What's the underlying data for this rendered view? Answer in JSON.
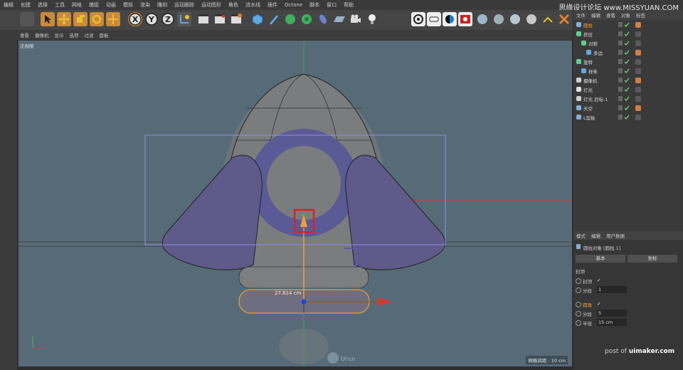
{
  "menubar": {
    "items": [
      "编辑",
      "创建",
      "选择",
      "工具",
      "网格",
      "捕捉",
      "动画",
      "模拟",
      "渲染",
      "雕刻",
      "运动跟踪",
      "运动图形",
      "角色",
      "流水线",
      "插件",
      "Octane",
      "脚本",
      "窗口",
      "帮助"
    ],
    "watermark": "思缘设计论坛 www.MISSYUAN.COM"
  },
  "toolbar": {
    "axis_x": "X",
    "axis_y": "Y",
    "axis_z": "Z"
  },
  "viewport_header": {
    "items": [
      "查看",
      "摄像机",
      "显示",
      "选项",
      "过滤",
      "面板"
    ]
  },
  "viewport": {
    "label": "正视图",
    "measure": "27.614 cm",
    "grid_info": "网格间距 : 10 cm",
    "logo_text": "UI·cn"
  },
  "object_manager": {
    "header": [
      "文件",
      "编辑",
      "查看",
      "对象",
      "标签"
    ],
    "objects": [
      {
        "name": "圆柱",
        "indent": 0,
        "icon": "cylinder-icon",
        "color": "#7fb0e0",
        "highlight": true
      },
      {
        "name": "挤压",
        "indent": 0,
        "icon": "extrude-icon",
        "color": "#5fcf8a",
        "highlight": false
      },
      {
        "name": "对称",
        "indent": 1,
        "icon": "symmetry-icon",
        "color": "#5fcf8a",
        "highlight": false
      },
      {
        "name": "多边",
        "indent": 2,
        "icon": "polygon-spline-icon",
        "color": "#5fa8e0",
        "highlight": false
      },
      {
        "name": "旋转",
        "indent": 0,
        "icon": "lathe-icon",
        "color": "#5fcf8a",
        "highlight": false
      },
      {
        "name": "样条",
        "indent": 1,
        "icon": "spline-icon",
        "color": "#5fa8e0",
        "highlight": false
      },
      {
        "name": "摄像机",
        "indent": 0,
        "icon": "camera-icon",
        "color": "#cfcfcf",
        "highlight": false
      },
      {
        "name": "灯光",
        "indent": 0,
        "icon": "light-icon",
        "color": "#e0e0e0",
        "highlight": false
      },
      {
        "name": "灯光.目标.1",
        "indent": 0,
        "icon": "target-icon",
        "color": "#cfcfcf",
        "highlight": false
      },
      {
        "name": "天空",
        "indent": 0,
        "icon": "sky-icon",
        "color": "#7fb0e0",
        "highlight": false
      },
      {
        "name": "L型板",
        "indent": 0,
        "icon": "l-board-icon",
        "color": "#7fb0e0",
        "highlight": false
      }
    ]
  },
  "attributes": {
    "tabs": [
      "模式",
      "编辑",
      "用户数据"
    ],
    "title": "圆柱对象 [圆柱.1]",
    "subtabs": [
      "基本",
      "坐标"
    ],
    "section": "封顶",
    "cap_label": "封顶",
    "cap_check": "✓",
    "seg1_label": "分段",
    "seg1_value": "1",
    "fillet_label": "圆角",
    "fillet_check": "✓",
    "seg2_label": "分段",
    "seg2_value": "5",
    "radius_label": "半径",
    "radius_value": "15 cm"
  },
  "footer": {
    "post_of": "post of",
    "site": "uimaker.com"
  },
  "colors": {
    "viewport_bg": "#566b77",
    "selection_orange": "#f0a030",
    "highlight_red": "#e02020",
    "torus_purple": "#5a5a96"
  }
}
